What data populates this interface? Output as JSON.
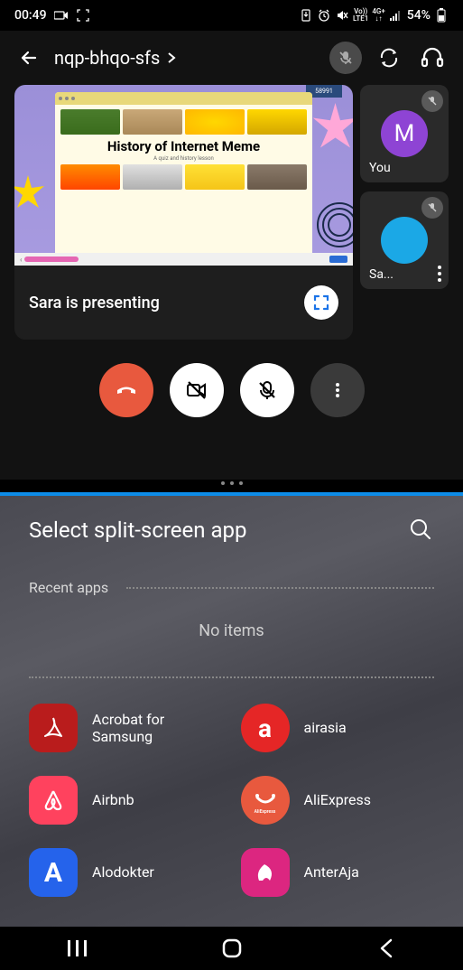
{
  "status": {
    "time": "00:49",
    "battery": "54%",
    "net1": "Vo))",
    "net2": "LTE1",
    "net3": "4G+",
    "net4": "↓↑"
  },
  "call": {
    "title": "nqp-bhqo-sfs",
    "slide_title": "History of Internet Meme",
    "slide_sub": "A quiz and history lesson",
    "slide_tape": "58991",
    "presenter_text": "Sara is presenting",
    "you_label": "You",
    "you_initial": "M",
    "p2_label": "Sa..."
  },
  "picker": {
    "title": "Select split-screen app",
    "recent_label": "Recent apps",
    "no_items": "No items",
    "apps": [
      {
        "name": "Acrobat for Samsung"
      },
      {
        "name": "airasia"
      },
      {
        "name": "Airbnb"
      },
      {
        "name": "AliExpress"
      },
      {
        "name": "Alodokter"
      },
      {
        "name": "AnterAja"
      }
    ]
  }
}
